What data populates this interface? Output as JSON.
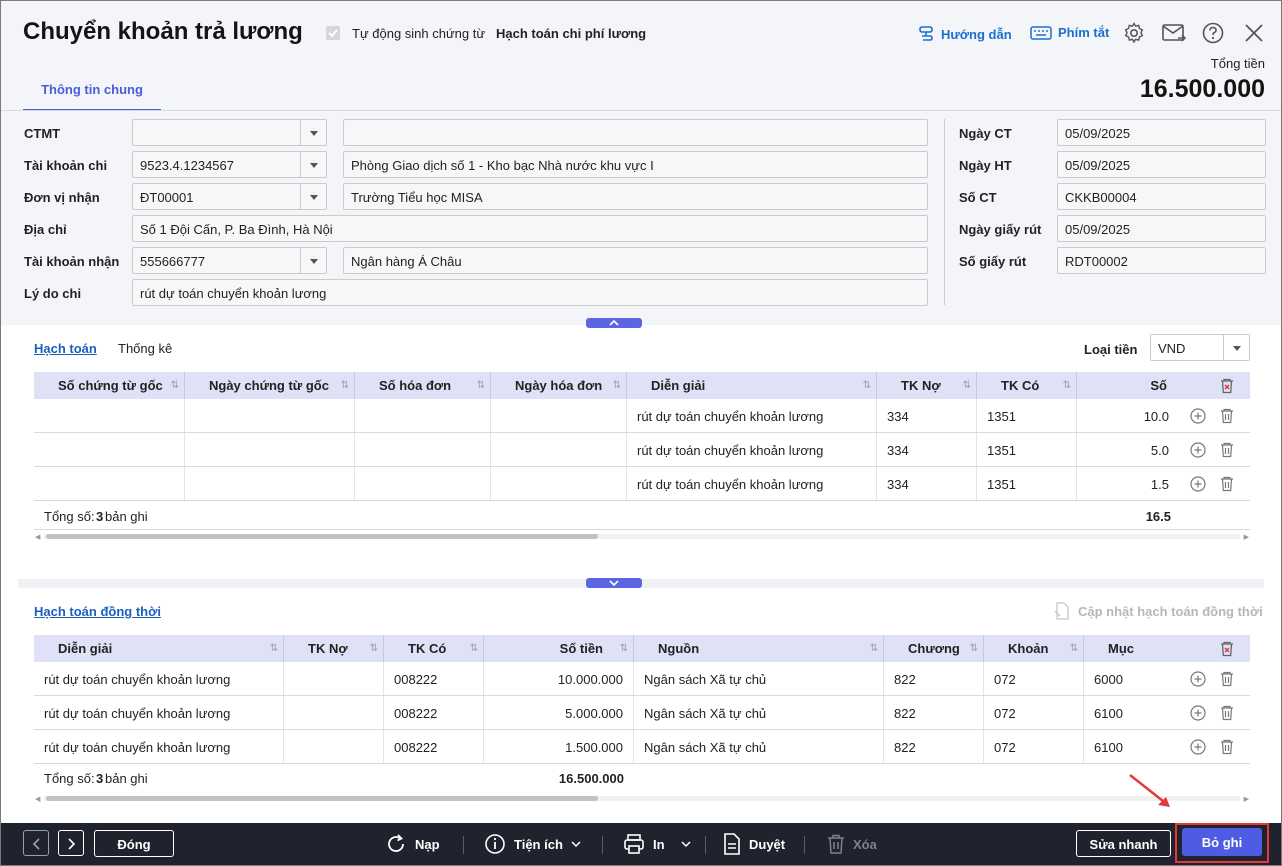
{
  "header": {
    "title": "Chuyển khoản trả lương",
    "auto_gen_label": "Tự động sinh chứng từ",
    "auto_gen_value": "Hạch toán chi phí lương",
    "guide_label": "Hướng dẫn",
    "shortcut_label": "Phím tắt",
    "total_label": "Tổng tiền",
    "total_value": "16.500.000",
    "tab_general": "Thông tin chung"
  },
  "form": {
    "ctmt": {
      "label": "CTMT",
      "code": "",
      "name": ""
    },
    "account_out": {
      "label": "Tài khoản chi",
      "code": "9523.4.1234567",
      "name": "Phòng Giao dịch số 1 - Kho bạc Nhà nước khu vực I"
    },
    "receiver": {
      "label": "Đơn vị nhận",
      "code": "ĐT00001",
      "name": "Trường Tiểu học MISA"
    },
    "address": {
      "label": "Địa chỉ",
      "value": "Số 1 Đội Cấn, P. Ba Đình, Hà Nội"
    },
    "account_in": {
      "label": "Tài khoản nhận",
      "code": "555666777",
      "name": "Ngân hàng Á Châu"
    },
    "reason": {
      "label": "Lý do chi",
      "value": "rút dự toán chuyển khoản lương"
    },
    "date_ct": {
      "label": "Ngày CT",
      "value": "05/09/2025"
    },
    "date_ht": {
      "label": "Ngày HT",
      "value": "05/09/2025"
    },
    "so_ct": {
      "label": "Số CT",
      "value": "CKKB00004"
    },
    "date_withdraw": {
      "label": "Ngày giấy rút",
      "value": "05/09/2025"
    },
    "so_withdraw": {
      "label": "Số giấy rút",
      "value": "RDT00002"
    }
  },
  "grid1": {
    "tab_active": "Hạch toán",
    "tab_other": "Thống kê",
    "currency_label": "Loại tiền",
    "currency_value": "VND",
    "columns": [
      "Số chứng từ gốc",
      "Ngày chứng từ gốc",
      "Số hóa đơn",
      "Ngày hóa đơn",
      "Diễn giải",
      "TK Nợ",
      "TK Có",
      "Số"
    ],
    "rows": [
      {
        "desc": "rút dự toán chuyển khoản lương",
        "debit": "334",
        "credit": "1351",
        "amount": "10.0"
      },
      {
        "desc": "rút dự toán chuyển khoản lương",
        "debit": "334",
        "credit": "1351",
        "amount": "5.0"
      },
      {
        "desc": "rút dự toán chuyển khoản lương",
        "debit": "334",
        "credit": "1351",
        "amount": "1.5"
      }
    ],
    "footer_prefix": "Tổng số: ",
    "footer_count": "3",
    "footer_suffix": " bản ghi",
    "footer_total": "16.5"
  },
  "grid2": {
    "tab_active": "Hạch toán đồng thời",
    "update_label": "Cập nhật hạch toán đồng thời",
    "columns": [
      "Diễn giải",
      "TK Nợ",
      "TK Có",
      "Số tiền",
      "Nguồn",
      "Chương",
      "Khoản",
      "Mục"
    ],
    "rows": [
      {
        "desc": "rút dự toán chuyển khoản lương",
        "debit": "",
        "credit": "008222",
        "amount": "10.000.000",
        "source": "Ngân sách Xã tự chủ",
        "chapter": "822",
        "item": "072",
        "sub": "6000"
      },
      {
        "desc": "rút dự toán chuyển khoản lương",
        "debit": "",
        "credit": "008222",
        "amount": "5.000.000",
        "source": "Ngân sách Xã tự chủ",
        "chapter": "822",
        "item": "072",
        "sub": "6100"
      },
      {
        "desc": "rút dự toán chuyển khoản lương",
        "debit": "",
        "credit": "008222",
        "amount": "1.500.000",
        "source": "Ngân sách Xã tự chủ",
        "chapter": "822",
        "item": "072",
        "sub": "6100"
      }
    ],
    "footer_prefix": "Tổng số: ",
    "footer_count": "3",
    "footer_suffix": " bản ghi",
    "footer_total": "16.500.000"
  },
  "bottom": {
    "close": "Đóng",
    "reload": "Nạp",
    "utility": "Tiện ích",
    "print": "In",
    "approve": "Duyệt",
    "delete": "Xóa",
    "quick_edit": "Sửa nhanh",
    "unpost": "Bỏ ghi"
  },
  "colors": {
    "accent": "#4d5ce3",
    "link": "#1b6fd1",
    "bottombar": "#20232e",
    "highlight": "#e23a3a"
  }
}
